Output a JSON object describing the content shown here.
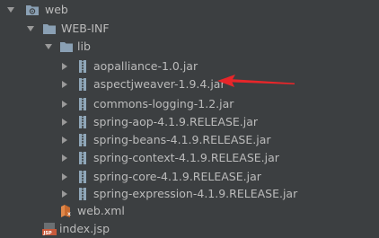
{
  "tree": {
    "root": {
      "label": "web",
      "icon": "folder-icon",
      "expanded": true
    },
    "webinf": {
      "label": "WEB-INF",
      "icon": "folder-icon",
      "expanded": true
    },
    "lib": {
      "label": "lib",
      "icon": "folder-icon",
      "expanded": true
    },
    "jars": [
      {
        "label": "aopalliance-1.0.jar",
        "icon": "jar-icon"
      },
      {
        "label": "aspectjweaver-1.9.4.jar",
        "icon": "jar-icon"
      },
      {
        "label": "commons-logging-1.2.jar",
        "icon": "jar-icon"
      },
      {
        "label": "spring-aop-4.1.9.RELEASE.jar",
        "icon": "jar-icon"
      },
      {
        "label": "spring-beans-4.1.9.RELEASE.jar",
        "icon": "jar-icon"
      },
      {
        "label": "spring-context-4.1.9.RELEASE.jar",
        "icon": "jar-icon"
      },
      {
        "label": "spring-core-4.1.9.RELEASE.jar",
        "icon": "jar-icon"
      },
      {
        "label": "spring-expression-4.1.9.RELEASE.jar",
        "icon": "jar-icon"
      }
    ],
    "webxml": {
      "label": "web.xml",
      "icon": "xml-file-icon"
    },
    "indexjsp": {
      "label": "index.jsp",
      "icon": "jsp-file-icon"
    }
  },
  "annotation": {
    "icon": "red-arrow-icon",
    "color": "#e8262a"
  },
  "colors": {
    "background": "#3c3f41",
    "text": "#bbbbbb",
    "folder": "#8aa0b4",
    "jar": "#8fa6b8",
    "arrow": "#9a9a9a"
  }
}
